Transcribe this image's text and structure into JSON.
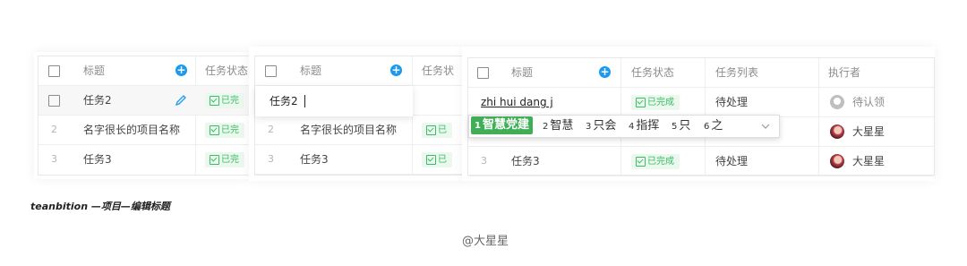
{
  "panel1": {
    "header": {
      "title": "标题",
      "status": "任务状态"
    },
    "rows": [
      {
        "num": "",
        "title": "任务2",
        "status": "已完"
      },
      {
        "num": "2",
        "title": "名字很长的项目名称",
        "status": "已完"
      },
      {
        "num": "3",
        "title": "任务3",
        "status": "已完"
      }
    ]
  },
  "panel2": {
    "header": {
      "title": "标题",
      "status": "任务状"
    },
    "edit_value": "任务2",
    "rows": [
      {
        "num": "2",
        "title": "名字很长的项目名称",
        "status": "已"
      },
      {
        "num": "3",
        "title": "任务3",
        "status": "已"
      }
    ]
  },
  "panel3": {
    "header": {
      "title": "标题",
      "status": "任务状态",
      "list": "任务列表",
      "assignee": "执行者"
    },
    "input_value": "zhi hui dang j",
    "rows": [
      {
        "num": "",
        "title": "",
        "status": "已完成",
        "list": "待处理",
        "assignee": "待认领"
      },
      {
        "num": "2",
        "title": "",
        "status": "",
        "list": "",
        "assignee": "大星星"
      },
      {
        "num": "3",
        "title": "任务3",
        "status": "已完成",
        "list": "待处理",
        "assignee": "大星星"
      }
    ],
    "ime": {
      "candidates": [
        {
          "n": "1",
          "text": "智慧党建"
        },
        {
          "n": "2",
          "text": "智慧"
        },
        {
          "n": "3",
          "text": "只会"
        },
        {
          "n": "4",
          "text": "指挥"
        },
        {
          "n": "5",
          "text": "只"
        },
        {
          "n": "6",
          "text": "之"
        }
      ]
    }
  },
  "caption": "teanbition —项目—编辑标题",
  "credit": "@大星星",
  "colors": {
    "accent": "#1b9aee",
    "done_bg": "#eaf8ee",
    "done_text": "#3ebb66",
    "ime_selected": "#3fae56"
  },
  "icons": [
    "plus-circle-icon",
    "pencil-icon",
    "checkbox-icon",
    "chevron-down-icon"
  ]
}
